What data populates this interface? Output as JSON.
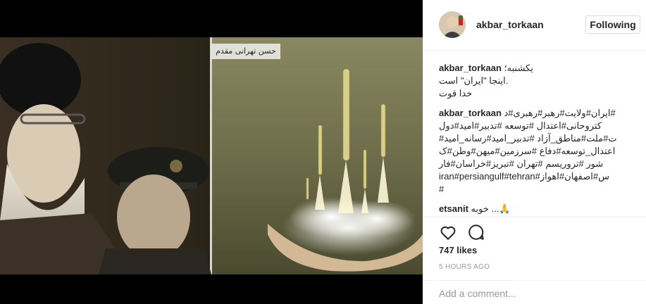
{
  "post": {
    "image_caption_text": "حسن تهرانی مقدم"
  },
  "header": {
    "username": "akbar_torkaan",
    "follow_label": "Following"
  },
  "comments": [
    {
      "user": "akbar_torkaan",
      "text": "یکشنبه؛\n.اینجا \"ایران\" است\nخدا قوت"
    },
    {
      "user": "akbar_torkaan",
      "text": "#ایران#ولایت#رهبر#رهبری#د\nکتروحانی#اعتدال #توسعه #تدبیر#امید#دول\nت#ملت#مناطق_آزاد #تدبیر_امید#رسانه_امید#\nاعتدال_توسعه#دفاع #سرزمین#میهن#وطن#ک\nشور #تروریسم #تهران #تبریز#خراسان#فار\nس#اصفهان#اهواز#iran#persiangulf#tehran\n#"
    },
    {
      "user": "etsanit",
      "text": "خوبه ...🙏"
    }
  ],
  "likes_text": "747 likes",
  "time_text": "5 HOURS AGO",
  "add_comment_placeholder": "Add a comment...",
  "icons": {
    "like": "heart-icon",
    "comment": "comment-bubble-icon"
  }
}
